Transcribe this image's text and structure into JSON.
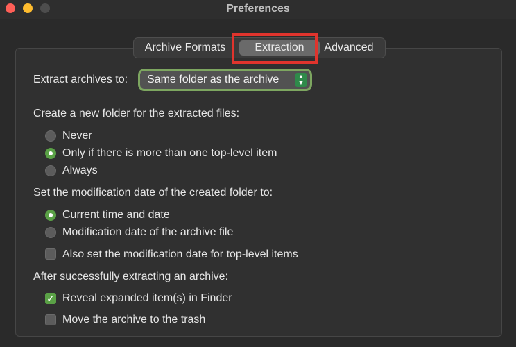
{
  "window": {
    "title": "Preferences"
  },
  "tabs": [
    {
      "label": "Archive Formats",
      "selected": false
    },
    {
      "label": "Extraction",
      "selected": true
    },
    {
      "label": "Advanced",
      "selected": false
    }
  ],
  "extract_to": {
    "label": "Extract archives to:",
    "value": "Same folder as the archive"
  },
  "new_folder": {
    "heading": "Create a new folder for the extracted files:",
    "options": [
      {
        "label": "Never",
        "selected": false
      },
      {
        "label": "Only if there is more than one top-level item",
        "selected": true
      },
      {
        "label": "Always",
        "selected": false
      }
    ]
  },
  "mod_date": {
    "heading": "Set the modification date of the created folder to:",
    "options": [
      {
        "label": "Current time and date",
        "selected": true
      },
      {
        "label": "Modification date of the archive file",
        "selected": false
      }
    ],
    "also_top_level": {
      "label": "Also set the modification date for top-level items",
      "checked": false
    }
  },
  "after_extract": {
    "heading": "After successfully extracting an archive:",
    "options": [
      {
        "label": "Reveal expanded item(s) in Finder",
        "checked": true
      },
      {
        "label": "Move the archive to the trash",
        "checked": false
      }
    ]
  },
  "colors": {
    "accent_green": "#5aa146",
    "highlight_red": "#e0342d"
  }
}
